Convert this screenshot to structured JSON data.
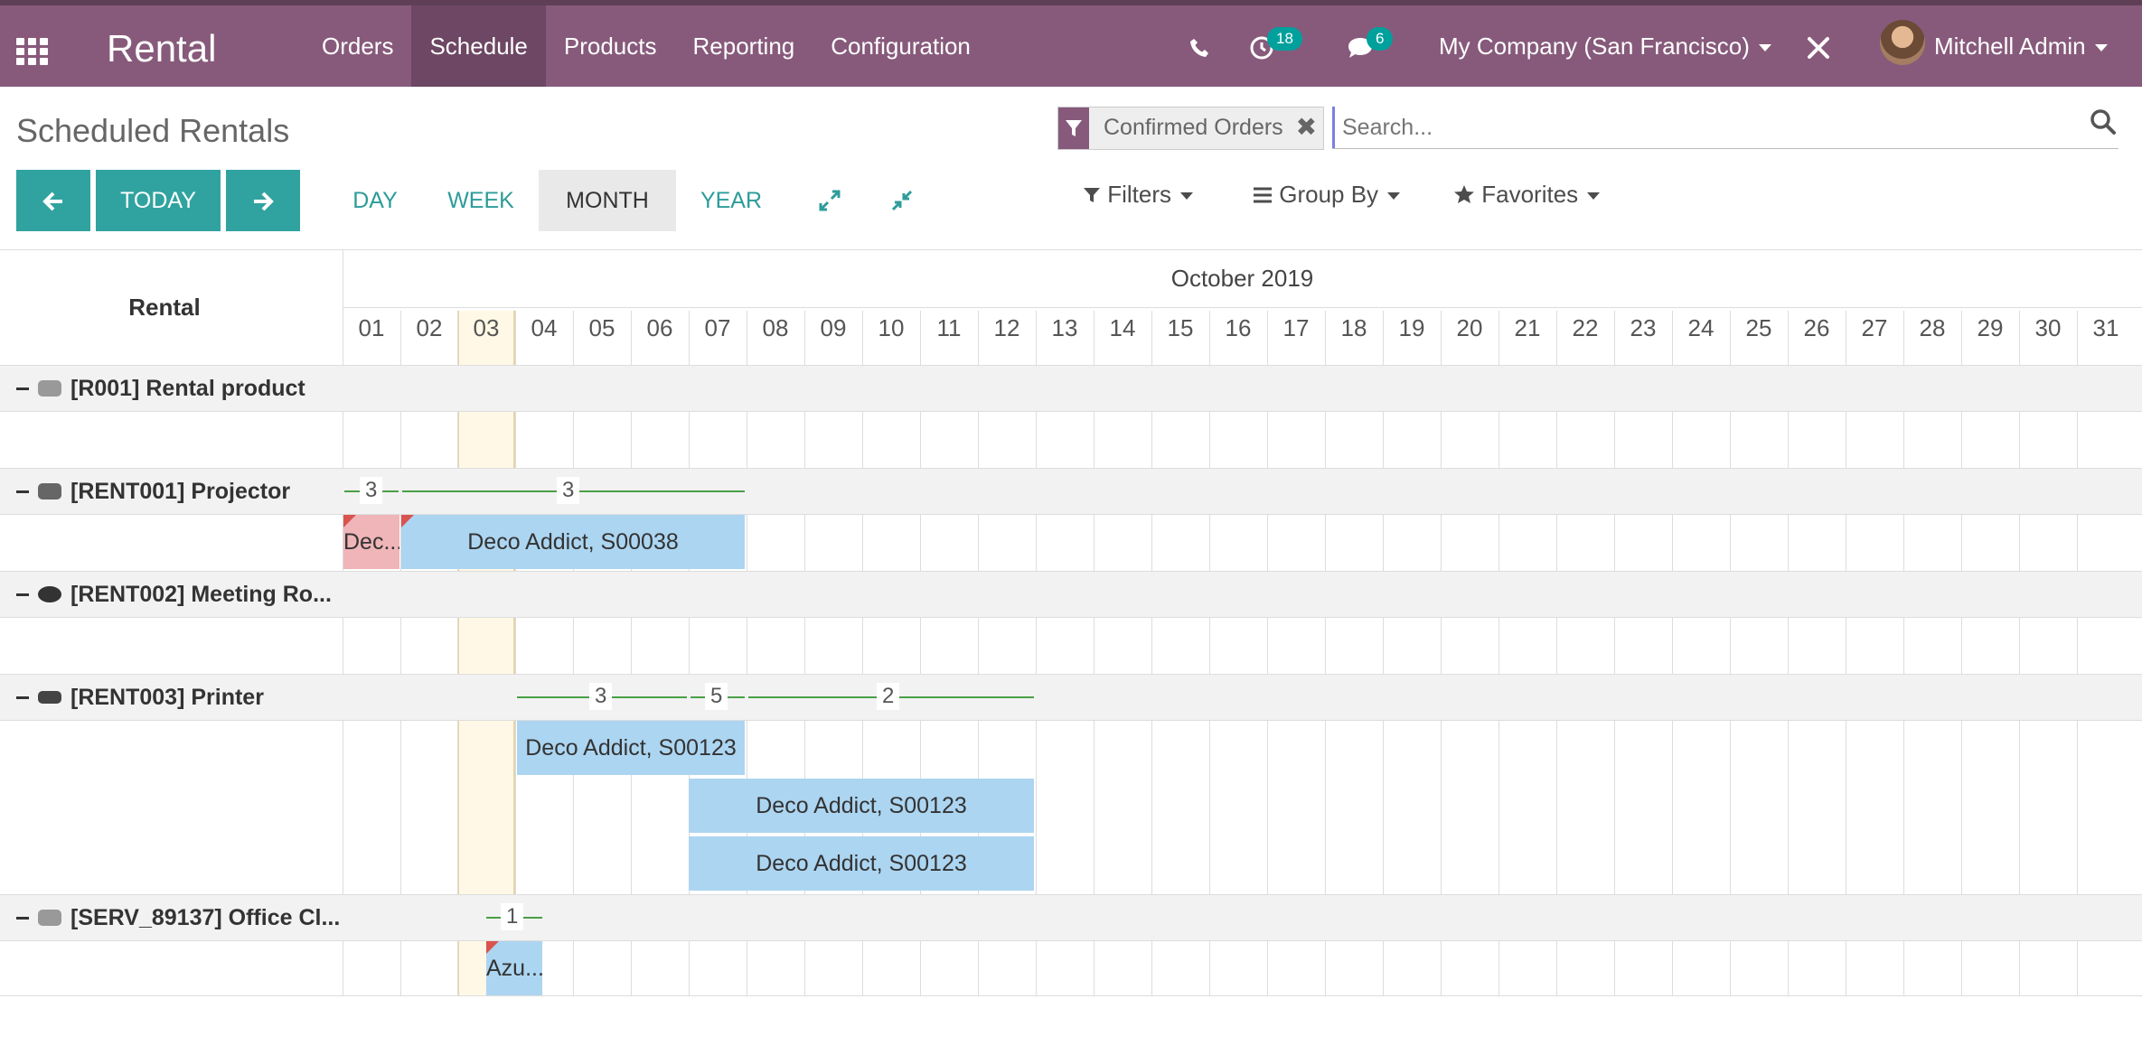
{
  "app": {
    "title": "Rental"
  },
  "menu": [
    {
      "label": "Orders",
      "active": false
    },
    {
      "label": "Schedule",
      "active": true
    },
    {
      "label": "Products",
      "active": false
    },
    {
      "label": "Reporting",
      "active": false
    },
    {
      "label": "Configuration",
      "active": false
    }
  ],
  "systray": {
    "activity_count": "18",
    "message_count": "6",
    "company": "My Company (San Francisco)",
    "user": "Mitchell Admin"
  },
  "control": {
    "title": "Scheduled Rentals",
    "today_label": "TODAY",
    "scales": [
      {
        "label": "DAY"
      },
      {
        "label": "WEEK"
      },
      {
        "label": "MONTH",
        "active": true
      },
      {
        "label": "YEAR"
      }
    ],
    "facet": "Confirmed Orders",
    "search_placeholder": "Search...",
    "filters_label": "Filters",
    "groupby_label": "Group By",
    "favorites_label": "Favorites"
  },
  "gantt": {
    "row_header": "Rental",
    "month": "October 2019",
    "days": [
      "01",
      "02",
      "03",
      "04",
      "05",
      "06",
      "07",
      "08",
      "09",
      "10",
      "11",
      "12",
      "13",
      "14",
      "15",
      "16",
      "17",
      "18",
      "19",
      "20",
      "21",
      "22",
      "23",
      "24",
      "25",
      "26",
      "27",
      "28",
      "29",
      "30",
      "31"
    ],
    "today_index": 2,
    "groups": [
      {
        "label": "[R001] Rental product"
      },
      {
        "label": "[RENT001] Projector"
      },
      {
        "label": "[RENT002] Meeting Ro..."
      },
      {
        "label": "[RENT003] Printer"
      },
      {
        "label": "[SERV_89137] Office Cl..."
      }
    ],
    "pills": [
      {
        "text": "Dec...",
        "red": true
      },
      {
        "text": "Deco Addict, S00038"
      },
      {
        "text": "Deco Addict, S00123"
      },
      {
        "text": "Deco Addict, S00123"
      },
      {
        "text": "Deco Addict, S00123"
      },
      {
        "text": "Azu..."
      }
    ],
    "consolidations": [
      {
        "value": "3"
      },
      {
        "value": "3"
      },
      {
        "value": "3"
      },
      {
        "value": "5"
      },
      {
        "value": "2"
      },
      {
        "value": "1"
      }
    ]
  },
  "colors": {
    "brand": "#875a7b",
    "accent": "#30a3a0",
    "pill": "#acd5f1",
    "pill_overdue": "#f0b5b8",
    "consolidation": "#49a046"
  }
}
